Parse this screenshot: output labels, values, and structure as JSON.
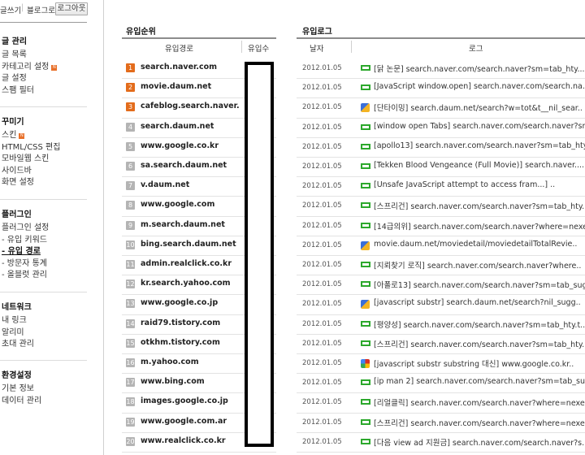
{
  "topbar": {
    "write": "글쓰기",
    "sep": "|",
    "blog": "블로그로",
    "logout": "로그아웃"
  },
  "sidebar": {
    "sections": [
      {
        "title": "글 관리",
        "items": [
          {
            "label": "글 목록"
          },
          {
            "label": "카테고리 설정",
            "new": true
          },
          {
            "label": "글 설정"
          },
          {
            "label": "스팸 필터"
          }
        ]
      },
      {
        "title": "꾸미기",
        "items": [
          {
            "label": "스킨",
            "new": true
          },
          {
            "label": "HTML/CSS 편집"
          },
          {
            "label": "모바일웹 스킨"
          },
          {
            "label": "사이드바"
          },
          {
            "label": "화면 설정"
          }
        ]
      },
      {
        "title": "플러그인",
        "items": [
          {
            "label": "플러그인 설정"
          },
          {
            "label": "- 유입 키워드"
          },
          {
            "label": "- 유입 경로",
            "active": true
          },
          {
            "label": "- 방문자 통계"
          },
          {
            "label": "- 올블럿 관리"
          }
        ]
      },
      {
        "title": "네트워크",
        "items": [
          {
            "label": "내 링크"
          },
          {
            "label": "알리미"
          },
          {
            "label": "초대 관리"
          }
        ]
      },
      {
        "title": "환경설정",
        "items": [
          {
            "label": "기본 정보"
          },
          {
            "label": "데이터 관리"
          }
        ]
      }
    ]
  },
  "ranking": {
    "title": "유입순위",
    "col_path": "유입경로",
    "col_count": "유입수",
    "rows": [
      {
        "rank": "1",
        "domain": "search.naver.com"
      },
      {
        "rank": "2",
        "domain": "movie.daum.net"
      },
      {
        "rank": "3",
        "domain": "cafeblog.search.naver...."
      },
      {
        "rank": "4",
        "domain": "search.daum.net"
      },
      {
        "rank": "5",
        "domain": "www.google.co.kr"
      },
      {
        "rank": "6",
        "domain": "sa.search.daum.net"
      },
      {
        "rank": "7",
        "domain": "v.daum.net"
      },
      {
        "rank": "8",
        "domain": "www.google.com"
      },
      {
        "rank": "9",
        "domain": "m.search.daum.net"
      },
      {
        "rank": "10",
        "domain": "bing.search.daum.net"
      },
      {
        "rank": "11",
        "domain": "admin.realclick.co.kr"
      },
      {
        "rank": "12",
        "domain": "kr.search.yahoo.com"
      },
      {
        "rank": "13",
        "domain": "www.google.co.jp"
      },
      {
        "rank": "14",
        "domain": "raid79.tistory.com"
      },
      {
        "rank": "15",
        "domain": "otkhm.tistory.com"
      },
      {
        "rank": "16",
        "domain": "m.yahoo.com"
      },
      {
        "rank": "17",
        "domain": "www.bing.com"
      },
      {
        "rank": "18",
        "domain": "images.google.co.jp"
      },
      {
        "rank": "19",
        "domain": "www.google.com.ar"
      },
      {
        "rank": "20",
        "domain": "www.realclick.co.kr"
      }
    ]
  },
  "log": {
    "title": "유입로그",
    "col_date": "날자",
    "col_log": "로그",
    "rows": [
      {
        "date": "2012.01.05",
        "icon": "naver",
        "text": "[닭 논문] search.naver.com/search.naver?sm=tab_hty..."
      },
      {
        "date": "2012.01.05",
        "icon": "naver",
        "text": "[JavaScript window.open] search.naver.com/search.na.."
      },
      {
        "date": "2012.01.05",
        "icon": "daum",
        "text": "[단타이밍] search.daum.net/search?w=tot&t__nil_sear.."
      },
      {
        "date": "2012.01.05",
        "icon": "naver",
        "text": "[window open Tabs] search.naver.com/search.naver?sm.."
      },
      {
        "date": "2012.01.05",
        "icon": "naver",
        "text": "[apollo13] search.naver.com/search.naver?sm=tab_hty.."
      },
      {
        "date": "2012.01.05",
        "icon": "naver",
        "text": "[Tekken Blood Vengeance (Full Movie)] search.naver...."
      },
      {
        "date": "2012.01.05",
        "icon": "naver",
        "text": "[Unsafe JavaScript attempt to access fram...] .."
      },
      {
        "date": "2012.01.05",
        "icon": "naver",
        "text": "[스프리건] search.naver.com/search.naver?sm=tab_hty.."
      },
      {
        "date": "2012.01.05",
        "icon": "naver",
        "text": "[14급의위] search.naver.com/search.naver?where=nexe.."
      },
      {
        "date": "2012.01.05",
        "icon": "daum",
        "text": "movie.daum.net/moviedetail/moviedetailTotalRevie.."
      },
      {
        "date": "2012.01.05",
        "icon": "naver",
        "text": "[지뢰찾기 로직] search.naver.com/search.naver?where.."
      },
      {
        "date": "2012.01.05",
        "icon": "naver",
        "text": "[아폴로13] search.naver.com/search.naver?sm=tab_sug.."
      },
      {
        "date": "2012.01.05",
        "icon": "daum",
        "text": "[javascript substr] search.daum.net/search?nil_sugg.."
      },
      {
        "date": "2012.01.05",
        "icon": "naver",
        "text": "[평양성] search.naver.com/search.naver?sm=tab_hty.t.."
      },
      {
        "date": "2012.01.05",
        "icon": "naver",
        "text": "[스프리건] search.naver.com/search.naver?sm=tab_hty.."
      },
      {
        "date": "2012.01.05",
        "icon": "google",
        "text": "[javascript substr substring 대신] www.google.co.kr.."
      },
      {
        "date": "2012.01.05",
        "icon": "naver",
        "text": "[ip man 2] search.naver.com/search.naver?sm=tab_sug.."
      },
      {
        "date": "2012.01.05",
        "icon": "naver",
        "text": "[리얼클릭] search.naver.com/search.naver?where=nexe.."
      },
      {
        "date": "2012.01.05",
        "icon": "naver",
        "text": "[스프리건] search.naver.com/search.naver?where=nexe.."
      },
      {
        "date": "2012.01.05",
        "icon": "naver",
        "text": "[다음 view ad 지원금] search.naver.com/search.naver?s.."
      }
    ]
  }
}
